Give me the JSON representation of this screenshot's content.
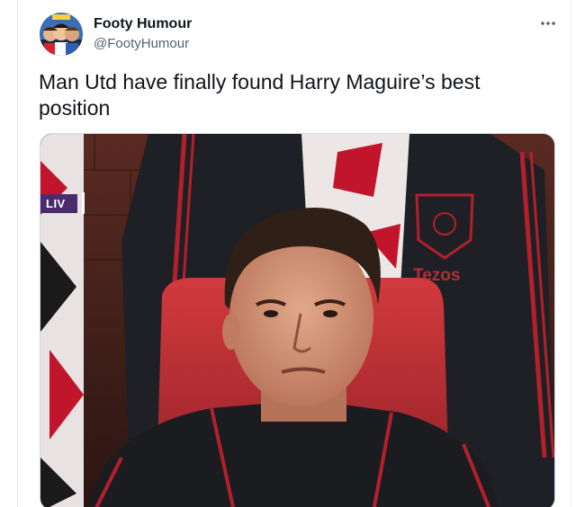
{
  "tweet": {
    "author": {
      "display_name": "Footy Humour",
      "handle": "@FootyHumour",
      "avatar_icon": "avatar-caricatures"
    },
    "more_icon": "more-options-icon",
    "text": "Man Utd have finally found Harry Maguire’s best position",
    "media": {
      "broadcaster_badge": "LIV",
      "shirt_sponsor": "Tezos",
      "description_icon": "photo"
    }
  },
  "colors": {
    "text_primary": "#0f1419",
    "text_secondary": "#536471",
    "border": "#cfd9de",
    "liv_purple": "#4b2a6e",
    "united_red": "#c8323c"
  }
}
